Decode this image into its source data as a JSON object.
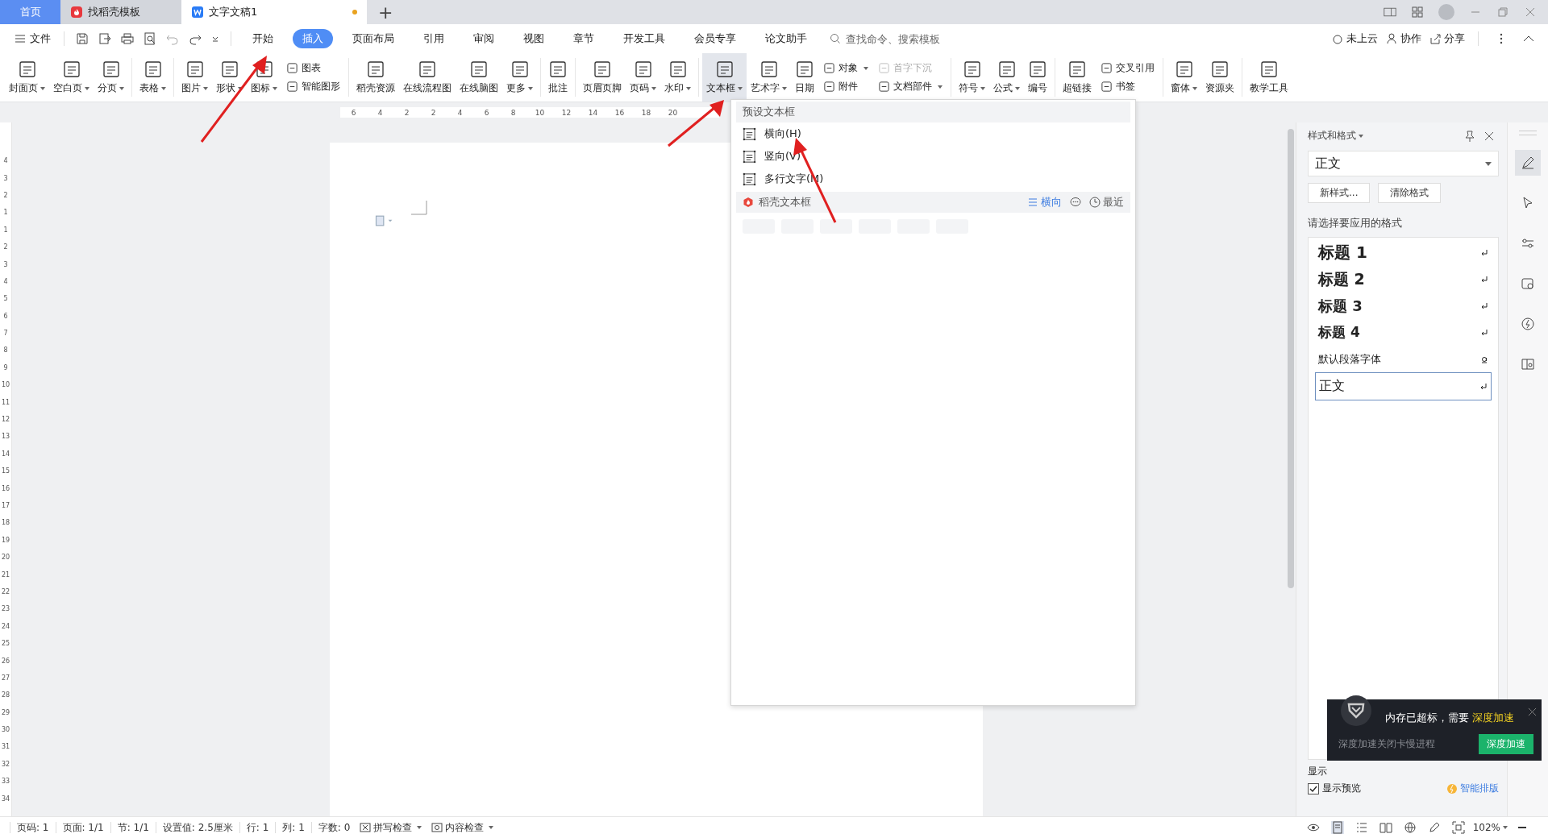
{
  "tabs": [
    {
      "label": "首页",
      "kind": "home",
      "selected": false
    },
    {
      "label": "找稻壳模板",
      "kind": "docer",
      "selected": false
    },
    {
      "label": "文字文稿1",
      "kind": "doc",
      "selected": true
    }
  ],
  "new_tab": "+",
  "menu": {
    "file": "文件",
    "items": [
      {
        "label": "开始",
        "selected": false
      },
      {
        "label": "插入",
        "selected": true
      },
      {
        "label": "页面布局",
        "selected": false
      },
      {
        "label": "引用",
        "selected": false
      },
      {
        "label": "审阅",
        "selected": false
      },
      {
        "label": "视图",
        "selected": false
      },
      {
        "label": "章节",
        "selected": false
      },
      {
        "label": "开发工具",
        "selected": false
      },
      {
        "label": "会员专享",
        "selected": false
      },
      {
        "label": "论文助手",
        "selected": false
      }
    ],
    "search": {
      "placeholder": "查找命令、搜索模板"
    },
    "right": [
      "未上云",
      "协作",
      "分享"
    ]
  },
  "ribbon": [
    [
      {
        "kind": "large",
        "label": "封面页",
        "dropdown": true,
        "active": false
      },
      {
        "kind": "large",
        "label": "空白页",
        "dropdown": true,
        "active": false
      },
      {
        "kind": "large",
        "label": "分页",
        "dropdown": true,
        "active": false
      }
    ],
    [
      {
        "kind": "large",
        "label": "表格",
        "dropdown": true,
        "active": false
      }
    ],
    [
      {
        "kind": "large",
        "label": "图片",
        "dropdown": true,
        "active": false
      },
      {
        "kind": "large",
        "label": "形状",
        "dropdown": true,
        "active": false
      },
      {
        "kind": "large",
        "label": "图标",
        "dropdown": true,
        "active": false
      },
      {
        "kind": "stack",
        "items": [
          {
            "label": "图表",
            "dropdown": false,
            "disabled": false
          },
          {
            "label": "智能图形",
            "dropdown": false,
            "disabled": false
          }
        ]
      }
    ],
    [
      {
        "kind": "large",
        "label": "稻壳资源",
        "dropdown": false,
        "active": false
      },
      {
        "kind": "large",
        "label": "在线流程图",
        "dropdown": false,
        "active": false
      },
      {
        "kind": "large",
        "label": "在线脑图",
        "dropdown": false,
        "active": false
      },
      {
        "kind": "large",
        "label": "更多",
        "dropdown": true,
        "active": false
      }
    ],
    [
      {
        "kind": "large",
        "label": "批注",
        "dropdown": false,
        "active": false
      }
    ],
    [
      {
        "kind": "large",
        "label": "页眉页脚",
        "dropdown": false,
        "active": false
      },
      {
        "kind": "large",
        "label": "页码",
        "dropdown": true,
        "active": false
      },
      {
        "kind": "large",
        "label": "水印",
        "dropdown": true,
        "active": false
      }
    ],
    [
      {
        "kind": "large",
        "label": "文本框",
        "dropdown": true,
        "active": true
      },
      {
        "kind": "large",
        "label": "艺术字",
        "dropdown": true,
        "active": false
      },
      {
        "kind": "large",
        "label": "日期",
        "dropdown": false,
        "active": false
      },
      {
        "kind": "stack",
        "items": [
          {
            "label": "对象",
            "dropdown": true,
            "disabled": false
          },
          {
            "label": "附件",
            "dropdown": false,
            "disabled": false
          }
        ]
      },
      {
        "kind": "stack",
        "items": [
          {
            "label": "首字下沉",
            "dropdown": false,
            "disabled": true
          },
          {
            "label": "文档部件",
            "dropdown": true,
            "disabled": false
          }
        ]
      }
    ],
    [
      {
        "kind": "large",
        "label": "符号",
        "dropdown": true,
        "active": false
      },
      {
        "kind": "large",
        "label": "公式",
        "dropdown": true,
        "active": false
      },
      {
        "kind": "large",
        "label": "编号",
        "dropdown": false,
        "active": false
      }
    ],
    [
      {
        "kind": "large",
        "label": "超链接",
        "dropdown": false,
        "active": false
      },
      {
        "kind": "stack",
        "items": [
          {
            "label": "交叉引用",
            "dropdown": false,
            "disabled": false
          },
          {
            "label": "书签",
            "dropdown": false,
            "disabled": false
          }
        ]
      }
    ],
    [
      {
        "kind": "large",
        "label": "窗体",
        "dropdown": true,
        "active": false
      },
      {
        "kind": "large",
        "label": "资源夹",
        "dropdown": false,
        "active": false
      }
    ],
    [
      {
        "kind": "large",
        "label": "教学工具",
        "dropdown": false,
        "active": false
      }
    ]
  ],
  "ruler": {
    "horizontal": [
      "6",
      "4",
      "2",
      "2",
      "4",
      "6",
      "8",
      "10",
      "12",
      "14",
      "16",
      "18",
      "20"
    ],
    "vertical": [
      "4",
      "3",
      "2",
      "1",
      "1",
      "2",
      "3",
      "4",
      "5",
      "6",
      "7",
      "8",
      "9",
      "10",
      "11",
      "12",
      "13",
      "14",
      "15",
      "16",
      "17",
      "18",
      "19",
      "20",
      "21",
      "22",
      "23",
      "24",
      "25",
      "26",
      "27",
      "28",
      "29",
      "30",
      "31",
      "32",
      "33",
      "34"
    ]
  },
  "textbox_menu": {
    "header": "预设文本框",
    "items": [
      {
        "label": "横向(H)"
      },
      {
        "label": "竖向(V)"
      },
      {
        "label": "多行文字(M)"
      }
    ],
    "docer_section": "稻壳文本框",
    "orientation": "横向",
    "recent": "最近"
  },
  "styles_panel": {
    "title": "样式和格式",
    "current": "正文",
    "buttons": [
      "新样式...",
      "清除格式"
    ],
    "prompt": "请选择要应用的格式",
    "styles": [
      {
        "label": "标题 1",
        "kind": "heading1",
        "selected": false
      },
      {
        "label": "标题 2",
        "kind": "heading2",
        "selected": false
      },
      {
        "label": "标题 3",
        "kind": "heading3",
        "selected": false
      },
      {
        "label": "标题 4",
        "kind": "heading4",
        "selected": false
      },
      {
        "label": "默认段落字体",
        "kind": "character",
        "selected": false
      },
      {
        "label": "正文",
        "kind": "paragraph",
        "selected": true
      }
    ],
    "show_label": "显示",
    "preview": {
      "label": "显示预览",
      "checked": true
    },
    "smart_layout": "智能排版"
  },
  "notification": {
    "message": "内存已超标，需要",
    "highlight": "深度加速",
    "detail": "深度加速关闭卡慢进程",
    "button": "深度加速"
  },
  "status_bar": {
    "items": [
      "页码: 1",
      "页面: 1/1",
      "节: 1/1",
      "设置值: 2.5厘米",
      "行: 1",
      "列: 1",
      "字数: 0"
    ],
    "checks": [
      "拼写检查",
      "内容检查"
    ],
    "zoom": "102%"
  }
}
